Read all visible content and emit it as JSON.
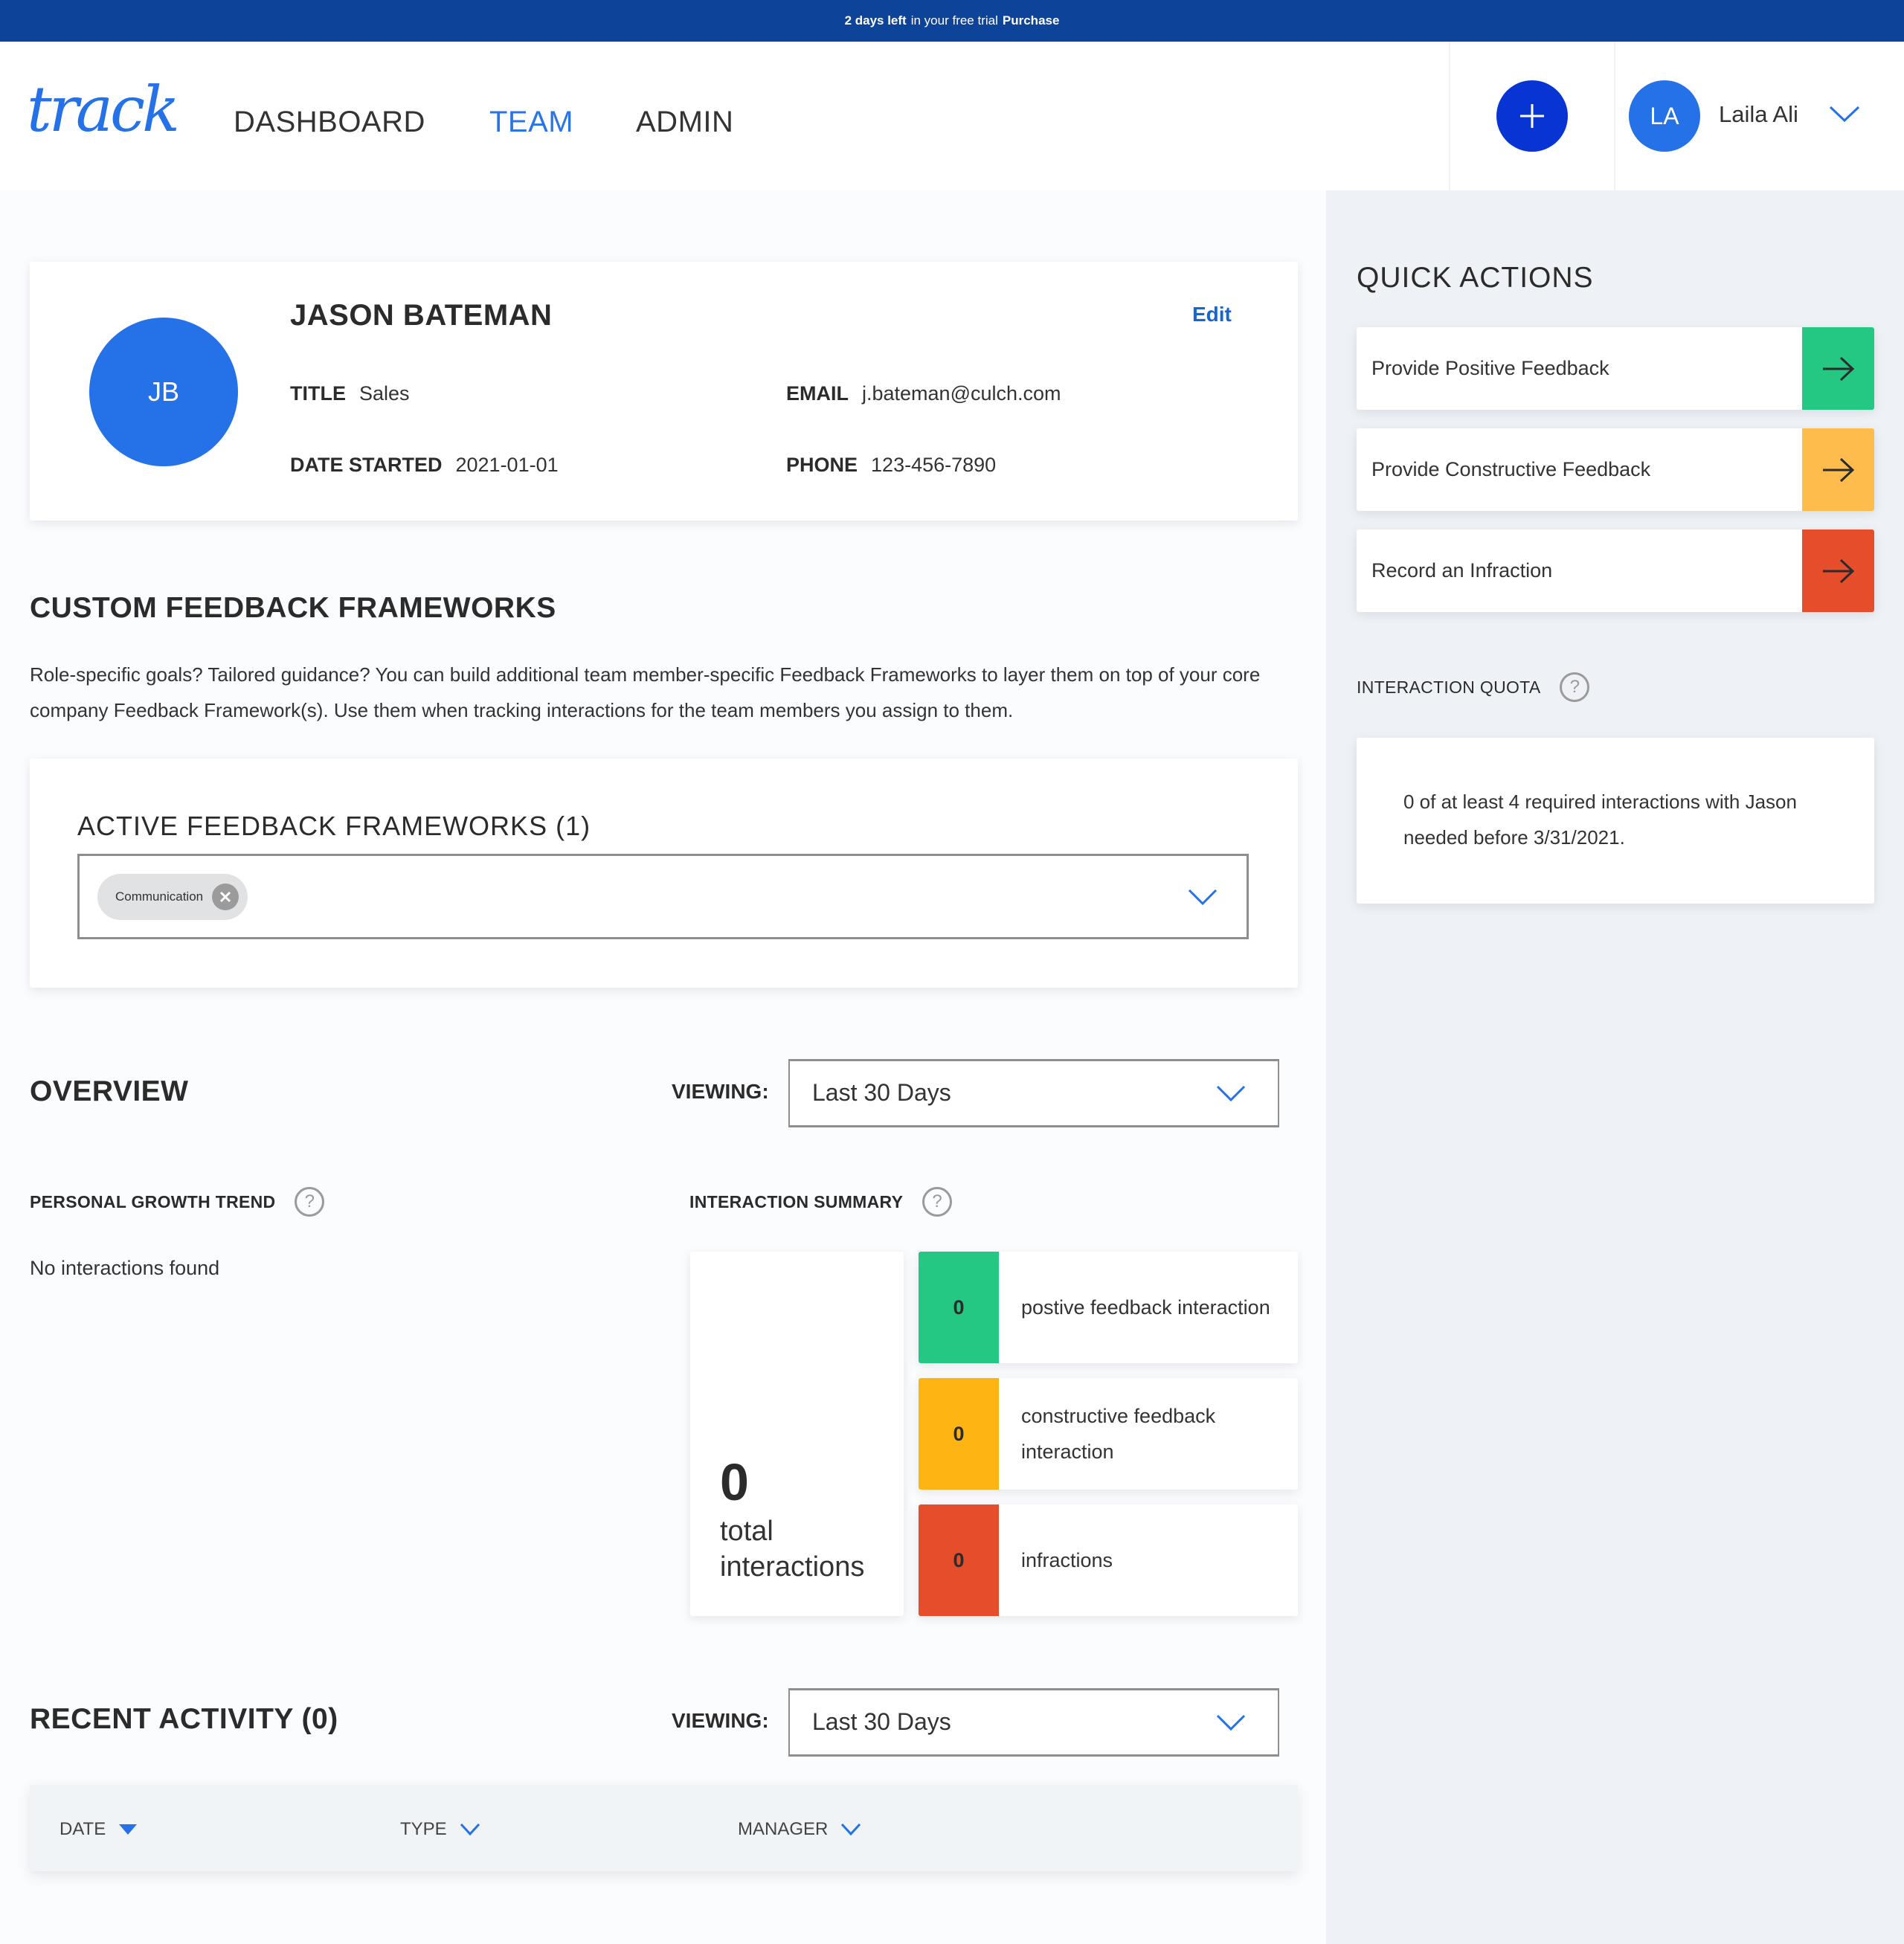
{
  "banner": {
    "days_left": "2 days left",
    "middle": "in your free trial",
    "purchase_label": "Purchase"
  },
  "header": {
    "logo": "track",
    "nav": [
      {
        "label": "DASHBOARD",
        "active": false
      },
      {
        "label": "TEAM",
        "active": true
      },
      {
        "label": "ADMIN",
        "active": false
      }
    ],
    "add_button_icon": "plus-icon",
    "user": {
      "initials": "LA",
      "name": "Laila Ali",
      "menu_icon": "chevron-down-icon"
    }
  },
  "profile": {
    "initials": "JB",
    "name": "JASON BATEMAN",
    "edit_label": "Edit",
    "fields": {
      "title": {
        "label": "TITLE",
        "value": "Sales"
      },
      "email": {
        "label": "EMAIL",
        "value": "j.bateman@culch.com"
      },
      "date_started": {
        "label": "DATE STARTED",
        "value": "2021-01-01"
      },
      "phone": {
        "label": "PHONE",
        "value": "123-456-7890"
      }
    }
  },
  "custom_frameworks": {
    "title": "CUSTOM FEEDBACK FRAMEWORKS",
    "description": "Role-specific goals? Tailored guidance? You can build additional team member-specific Feedback Frameworks to layer them on top of your core company Feedback Framework(s). Use them when tracking interactions for the team members you assign to them.",
    "active_title": "ACTIVE FEEDBACK FRAMEWORKS (1)",
    "selected": [
      {
        "label": "Communication",
        "remove_icon": "close-icon"
      }
    ]
  },
  "overview": {
    "title": "OVERVIEW",
    "viewing_label": "VIEWING:",
    "viewing_value": "Last 30 Days",
    "growth_trend": {
      "title": "PERSONAL GROWTH TREND",
      "empty_text": "No interactions found"
    },
    "summary": {
      "title": "INTERACTION SUMMARY",
      "total": {
        "value": "0",
        "label": "total interactions"
      },
      "rows": [
        {
          "value": "0",
          "label": "postive feedback interaction",
          "color": "#25c883"
        },
        {
          "value": "0",
          "label": "constructive feedback interaction",
          "color": "#feb513"
        },
        {
          "value": "0",
          "label": "infractions",
          "color": "#e64d2b"
        }
      ]
    }
  },
  "recent_activity": {
    "title": "RECENT ACTIVITY (0)",
    "viewing_label": "VIEWING:",
    "viewing_value": "Last 30 Days",
    "columns": [
      {
        "label": "DATE",
        "sort": "active-desc"
      },
      {
        "label": "TYPE",
        "sort": "chevron"
      },
      {
        "label": "MANAGER",
        "sort": "chevron"
      }
    ]
  },
  "quick_actions": {
    "title": "QUICK ACTIONS",
    "items": [
      {
        "label": "Provide Positive Feedback",
        "color": "#25c883",
        "icon": "arrow-right-icon"
      },
      {
        "label": "Provide Constructive Feedback",
        "color": "#fdbc4b",
        "icon": "arrow-right-icon"
      },
      {
        "label": "Record an Infraction",
        "color": "#e64d2b",
        "icon": "arrow-right-icon"
      }
    ]
  },
  "interaction_quota": {
    "title": "INTERACTION QUOTA",
    "text": "0 of at least 4 required interactions with Jason needed before 3/31/2021."
  },
  "colors": {
    "banner": "#0d4499",
    "accent": "#2471e8",
    "add_button": "#0834d4",
    "link": "#1466d2"
  }
}
